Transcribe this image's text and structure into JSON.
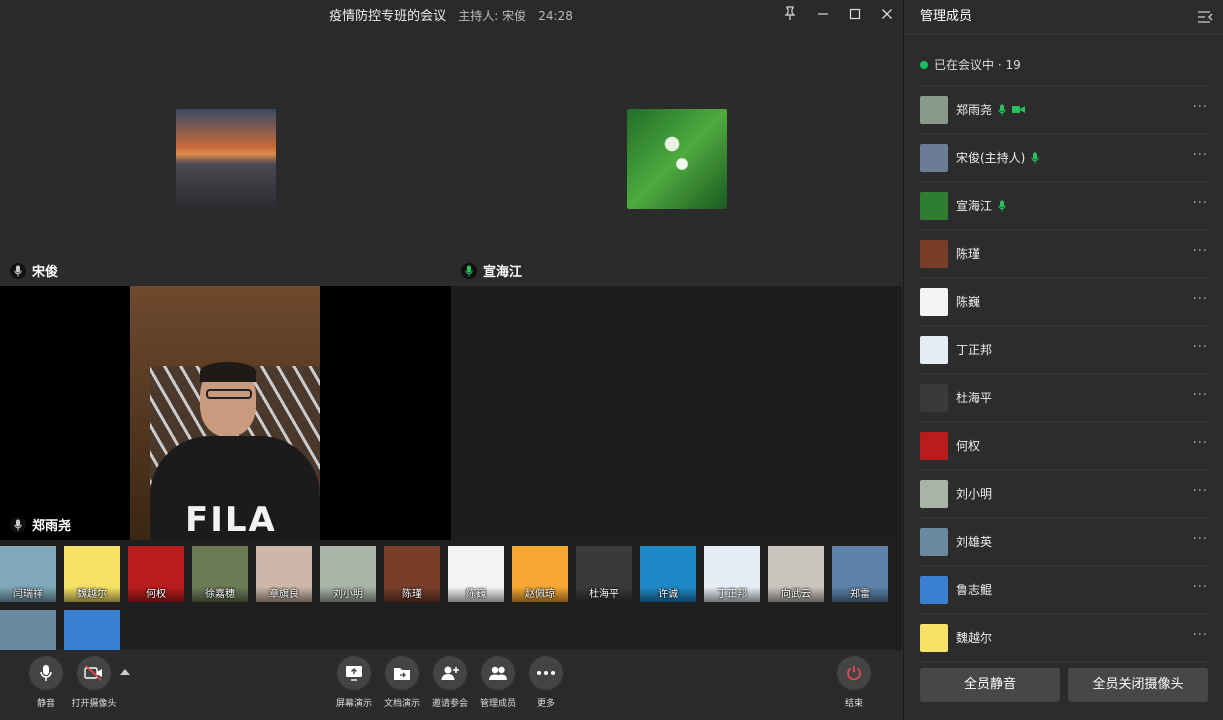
{
  "window": {
    "title": "疫情防控专班的会议",
    "host_label": "主持人: 宋俊",
    "timer": "24:28"
  },
  "tiles": [
    {
      "name": "宋俊",
      "mic_color": "#cccccc"
    },
    {
      "name": "宣海江",
      "mic_color": "#22c55e"
    }
  ],
  "video": {
    "speaker_name": "郑雨尧",
    "shirt_logo": "FILA"
  },
  "thumbnails": [
    {
      "name": "闫瑞祥",
      "color": "#7fa8b8"
    },
    {
      "name": "魏越尔",
      "color": "#f5e266"
    },
    {
      "name": "何权",
      "color": "#b91c1c"
    },
    {
      "name": "徐嘉穗",
      "color": "#6a7b55"
    },
    {
      "name": "章旗良",
      "color": "#cdb7a8"
    },
    {
      "name": "刘小明",
      "color": "#a9b4a8"
    },
    {
      "name": "陈瑾",
      "color": "#7a3d2a"
    },
    {
      "name": "陈巍",
      "color": "#f3f3f3"
    },
    {
      "name": "赵佩琼",
      "color": "#f7a632"
    },
    {
      "name": "杜海平",
      "color": "#3a3a3a"
    },
    {
      "name": "许诚",
      "color": "#1e88c8"
    },
    {
      "name": "丁正邦",
      "color": "#e6ecf5"
    },
    {
      "name": "向武云",
      "color": "#c9c4bd"
    },
    {
      "name": "郑雷",
      "color": "#5d83a8"
    },
    {
      "name": "",
      "color": "#6a8aa0"
    },
    {
      "name": "",
      "color": "#3b7fd0"
    }
  ],
  "toolbar": {
    "mute": "静音",
    "camera": "打开摄像头",
    "screen_share": "屏幕演示",
    "doc_share": "文档演示",
    "invite": "邀请参会",
    "manage": "管理成员",
    "more": "更多",
    "end": "结束"
  },
  "panel": {
    "title": "管理成员",
    "status": "已在会议中 · 19",
    "members": [
      {
        "name": "郑雨尧",
        "color": "#8a9a8c",
        "mic": true,
        "cam": true
      },
      {
        "name": "宋俊(主持人)",
        "color": "#6b7d94",
        "mic": true,
        "cam": false
      },
      {
        "name": "宣海江",
        "color": "#2f7d32",
        "mic": true,
        "cam": false
      },
      {
        "name": "陈瑾",
        "color": "#7a3d2a",
        "mic": false,
        "cam": false
      },
      {
        "name": "陈巍",
        "color": "#f3f3f3",
        "mic": false,
        "cam": false
      },
      {
        "name": "丁正邦",
        "color": "#e6ecf5",
        "mic": false,
        "cam": false
      },
      {
        "name": "杜海平",
        "color": "#3a3a3a",
        "mic": false,
        "cam": false
      },
      {
        "name": "何权",
        "color": "#b91c1c",
        "mic": false,
        "cam": false
      },
      {
        "name": "刘小明",
        "color": "#a9b4a8",
        "mic": false,
        "cam": false
      },
      {
        "name": "刘雄英",
        "color": "#6a8aa0",
        "mic": false,
        "cam": false
      },
      {
        "name": "鲁志鲲",
        "color": "#3b7fd0",
        "mic": false,
        "cam": false
      },
      {
        "name": "魏越尔",
        "color": "#f5e266",
        "mic": false,
        "cam": false
      }
    ],
    "mute_all": "全员静音",
    "cam_off_all": "全员关闭摄像头"
  },
  "colors": {
    "accent_green": "#22c55e",
    "end_red": "#e5484d"
  }
}
